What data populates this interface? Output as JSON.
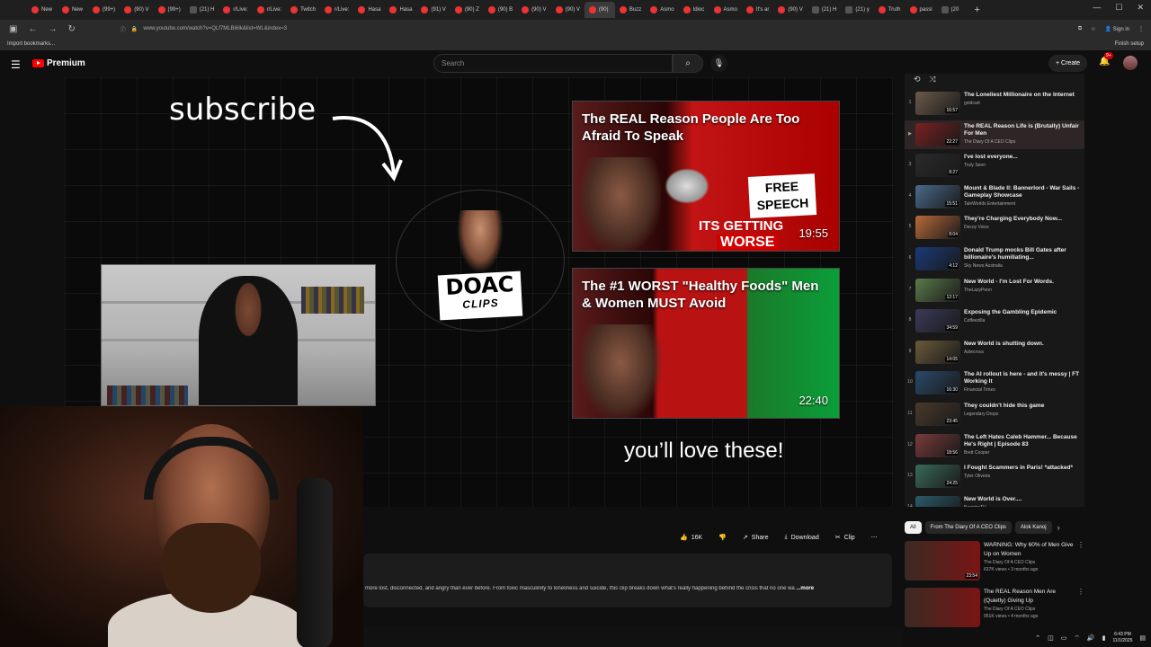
{
  "browser": {
    "tabs": [
      {
        "label": "New"
      },
      {
        "label": "New"
      },
      {
        "label": "(99+)"
      },
      {
        "label": "(90) V"
      },
      {
        "label": "(99+)"
      },
      {
        "label": "(21) H"
      },
      {
        "label": "r/Live:"
      },
      {
        "label": "r/Live:"
      },
      {
        "label": "Twitch"
      },
      {
        "label": "r/Live:"
      },
      {
        "label": "Hasa"
      },
      {
        "label": "Hasa"
      },
      {
        "label": "(91) V"
      },
      {
        "label": "(90) Z"
      },
      {
        "label": "(90) B"
      },
      {
        "label": "(90) V"
      },
      {
        "label": "(90) V"
      },
      {
        "label": "(90)"
      },
      {
        "label": "Buzz"
      },
      {
        "label": "Asmo"
      },
      {
        "label": "Idioc"
      },
      {
        "label": "Asmo"
      },
      {
        "label": "It's ar"
      },
      {
        "label": "(90) V"
      },
      {
        "label": "(21) H"
      },
      {
        "label": "(21) y"
      },
      {
        "label": "Truth"
      },
      {
        "label": "passi"
      },
      {
        "label": "(20"
      }
    ],
    "url": "www.youtube.com/watch?v=QLf7MLBi6Ik&list=WL&index=3",
    "bookmarks": {
      "import": "Import bookmarks...",
      "finish": "Finish setup"
    },
    "signin": "Sign in"
  },
  "youtube": {
    "logo": "Premium",
    "search_placeholder": "Search",
    "create_label": "Create",
    "notif_count": "9+"
  },
  "player": {
    "subscribe_text": "subscribe",
    "love_text": "you’ll love these!",
    "doac_logo": {
      "line1": "DOAC",
      "line2": "CLIPS"
    },
    "cards": [
      {
        "title": "The REAL Reason People Are Too Afraid To Speak",
        "duration": "19:55",
        "sign": "FREE SPEECH",
        "caption1": "ITS GETTING",
        "caption2": "WORSE"
      },
      {
        "title": "The #1 WORST \"Healthy Foods\" Men & Women MUST Avoid",
        "duration": "22:40"
      }
    ]
  },
  "actions": {
    "like_count": "16K",
    "share_label": "Share",
    "download_label": "Download",
    "clip_label": "Clip"
  },
  "description": {
    "text": "more lost, disconnected, and angry than ever before. From toxic masculinity to loneliness and suicide, this clip breaks down what's really happening behind the crisis that no one wa",
    "more_label": "...more"
  },
  "playlist": {
    "items": [
      {
        "num": "1",
        "title": "The Loneliest Millionaire on the Internet",
        "channel": "goldcart",
        "duration": "16:57",
        "color": "#6b5a4a"
      },
      {
        "num": "▶",
        "title": "The REAL Reason Life is (Brutally) Unfair For Men",
        "channel": "The Diary Of A CEO Clips",
        "duration": "22:27",
        "color": "#7a2020"
      },
      {
        "num": "3",
        "title": "I've lost everyone...",
        "channel": "Truly Seen",
        "duration": "8:27",
        "color": "#2a2a2a"
      },
      {
        "num": "4",
        "title": "Mount & Blade II: Bannerlord - War Sails - Gameplay Showcase",
        "channel": "TaleWorlds Entertainment",
        "duration": "15:51",
        "color": "#4a6a8a"
      },
      {
        "num": "5",
        "title": "They're Charging Everybody Now...",
        "channel": "Decoy Voice",
        "duration": "8:04",
        "color": "#b86a3a"
      },
      {
        "num": "6",
        "title": "Donald Trump mocks Bill Gates after billionaire's humiliating...",
        "channel": "Sky News Australia",
        "duration": "4:12",
        "color": "#1a3a7a"
      },
      {
        "num": "7",
        "title": "New World - I'm Lost For Words.",
        "channel": "TheLazyPeon",
        "duration": "12:17",
        "color": "#5a7a4a"
      },
      {
        "num": "8",
        "title": "Exposing the Gambling Epidemic",
        "channel": "Coffeezilla",
        "duration": "34:59",
        "color": "#3a3a5a"
      },
      {
        "num": "9",
        "title": "New World is shutting down.",
        "channel": "Aztecross",
        "duration": "14:05",
        "color": "#6a5a3a"
      },
      {
        "num": "10",
        "title": "The AI rollout is here - and it's messy | FT Working It",
        "channel": "Financial Times",
        "duration": "16:30",
        "color": "#2a4a6a"
      },
      {
        "num": "11",
        "title": "They couldn't hide this game",
        "channel": "Legendary Drops",
        "duration": "23:45",
        "color": "#4a3a2a"
      },
      {
        "num": "12",
        "title": "The Left Hates Caleb Hammer... Because He's Right | Episode 83",
        "channel": "Brett Cooper",
        "duration": "18:56",
        "color": "#7a3a3a"
      },
      {
        "num": "13",
        "title": "I Fought Scammers in Paris! *attacked*",
        "channel": "Tyler Oliveira",
        "duration": "24:25",
        "color": "#3a6a5a"
      },
      {
        "num": "14",
        "title": "New World is Over....",
        "channel": "BagginsTV",
        "duration": "",
        "color": "#2a5a6a"
      }
    ]
  },
  "chips": [
    {
      "label": "All",
      "selected": true
    },
    {
      "label": "From The Diary Of A CEO Clips",
      "selected": false
    },
    {
      "label": "Alok Kanoj",
      "selected": false
    }
  ],
  "recommendations": [
    {
      "title": "WARNING: Why 60% of Men Give Up on Women",
      "channel": "The Diary Of A CEO Clips",
      "meta": "637K views • 3 months ago",
      "duration": "23:54"
    },
    {
      "title": "The REAL Reason Men Are (Quietly) Giving Up",
      "channel": "The Diary Of A CEO Clips",
      "meta": "951K views • 4 months ago",
      "duration": ""
    }
  ],
  "system": {
    "time": "6:43 PM",
    "date": "11/1/2025"
  }
}
